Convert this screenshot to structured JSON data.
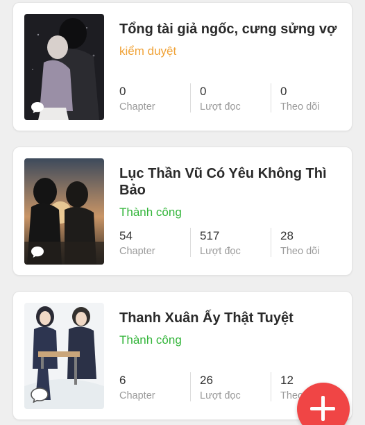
{
  "stories": [
    {
      "title": "Tổng tài giả ngốc, cưng sửng vợ",
      "status": "kiểm duyệt",
      "stats": [
        {
          "value": "0",
          "label": "Chapter"
        },
        {
          "value": "0",
          "label": "Lượt đọc"
        },
        {
          "value": "0",
          "label": "Theo dõi"
        }
      ]
    },
    {
      "title": "Lục Thần Vũ Có Yêu Không Thì Bảo",
      "status": "Thành công",
      "stats": [
        {
          "value": "54",
          "label": "Chapter"
        },
        {
          "value": "517",
          "label": "Lượt đọc"
        },
        {
          "value": "28",
          "label": "Theo dõi"
        }
      ]
    },
    {
      "title": "Thanh Xuân Ấy Thật Tuyệt",
      "status": "Thành công",
      "stats": [
        {
          "value": "6",
          "label": "Chapter"
        },
        {
          "value": "26",
          "label": "Lượt đọc"
        },
        {
          "value": "12",
          "label": "Theo dõi"
        }
      ]
    }
  ],
  "fab": {
    "icon": "plus-icon",
    "color": "#f04545"
  },
  "colors": {
    "status_pending": "#f0a236",
    "status_success": "#33b53a"
  }
}
